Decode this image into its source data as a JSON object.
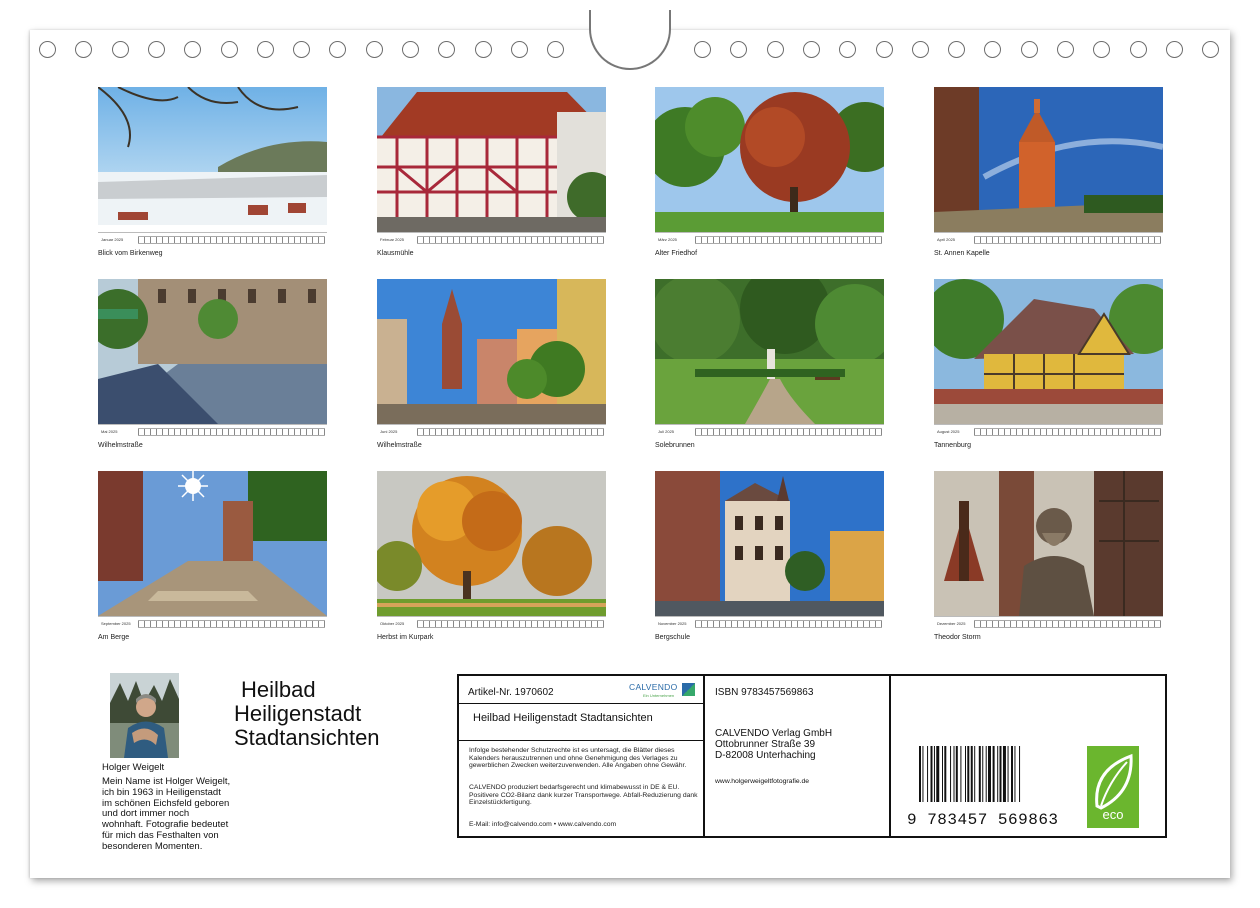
{
  "photos": [
    {
      "caption": "Blick vom Birkenweg",
      "month": "Januar 2025",
      "scene": "winter-village"
    },
    {
      "caption": "Klausmühle",
      "month": "Februar 2025",
      "scene": "timber-house"
    },
    {
      "caption": "Alter Friedhof",
      "month": "März 2025",
      "scene": "red-tree"
    },
    {
      "caption": "St. Annen Kapelle",
      "month": "April 2025",
      "scene": "chapel"
    },
    {
      "caption": "Wilhelmstraße",
      "month": "Mai 2025",
      "scene": "street-shade"
    },
    {
      "caption": "Wilhelmstraße",
      "month": "Juni 2025",
      "scene": "church-street"
    },
    {
      "caption": "Solebrunnen",
      "month": "Juli 2025",
      "scene": "park-fountain"
    },
    {
      "caption": "Tannenburg",
      "month": "August 2025",
      "scene": "yellow-house"
    },
    {
      "caption": "Am Berge",
      "month": "September 2025",
      "scene": "sun-lane"
    },
    {
      "caption": "Herbst im Kurpark",
      "month": "Oktober 2025",
      "scene": "autumn-tree"
    },
    {
      "caption": "Bergschule",
      "month": "November 2025",
      "scene": "school"
    },
    {
      "caption": "Theodor Storm",
      "month": "Dezember 2025",
      "scene": "statue"
    }
  ],
  "author": {
    "name": "Holger Weigelt",
    "bio": "Mein Name ist Holger Weigelt, ich bin 1963 in Heiligenstadt im schönen Eichsfeld geboren und dort immer noch wohnhaft. Fotografie bedeutet für mich das Festhalten von besonderen Momenten."
  },
  "title_lines": [
    "Heilbad",
    "Heiligenstadt",
    "Stadtansichten"
  ],
  "info": {
    "article": "Artikel-Nr. 1970602",
    "logo": "CALVENDO",
    "logo_sub": "Ein Unternehmen",
    "calendar_title": "Heilbad Heiligenstadt Stadtansichten",
    "legal1": "Infolge bestehender Schutzrechte ist es untersagt, die Blätter dieses Kalenders herauszutrennen und ohne Genehmigung des Verlages zu gewerblichen Zwecken weiterzuverwenden. Alle Angaben ohne Gewähr.",
    "legal2": "CALVENDO produziert bedarfsgerecht und klimabewusst in DE & EU. Positivere CO2-Bilanz dank kurzer Transportwege. Abfall-Reduzierung dank Einzelstückfertigung.",
    "email": "E-Mail: info@calvendo.com • www.calvendo.com",
    "isbn": "ISBN 9783457569863",
    "publisher_lines": [
      "CALVENDO Verlag GmbH",
      "Ottobrunner Straße 39",
      "D-82008 Unterhaching"
    ],
    "website": "www.holgerweigeltfotografie.de",
    "barcode_number": "9 783457 569863",
    "eco_label": "eco",
    "eco_color": "#6bb62e"
  }
}
